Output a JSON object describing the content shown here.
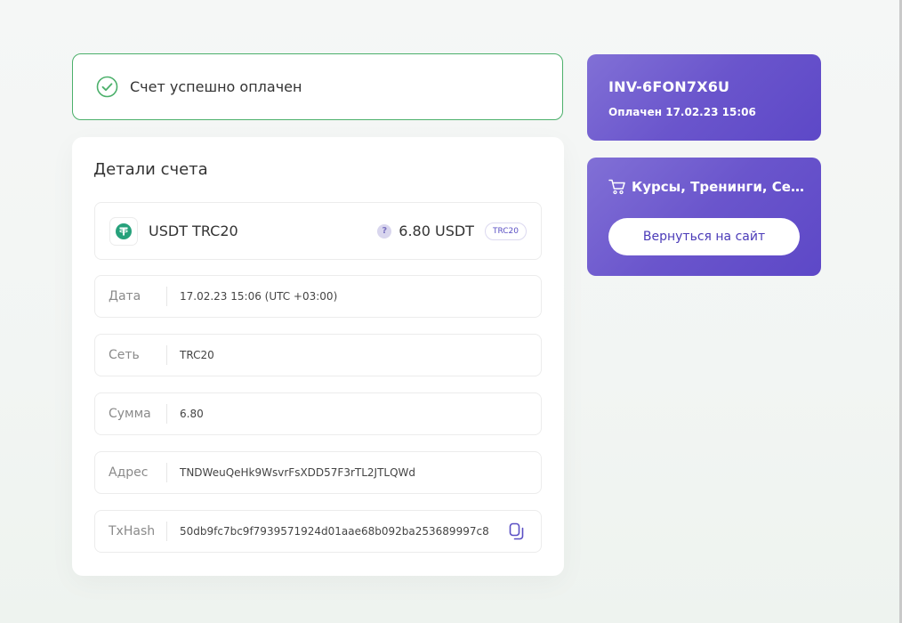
{
  "status": {
    "message": "Счет успешно оплачен"
  },
  "details": {
    "title": "Детали счета",
    "currency": {
      "name": "USDT TRC20",
      "amount": "6.80 USDT",
      "network_badge": "TRC20",
      "help_glyph": "?"
    },
    "rows": [
      {
        "label": "Дата",
        "value": "17.02.23 15:06 (UTC +03:00)"
      },
      {
        "label": "Сеть",
        "value": "TRC20"
      },
      {
        "label": "Сумма",
        "value": "6.80"
      },
      {
        "label": "Адрес",
        "value": "TNDWeuQeHk9WsvrFsXDD57F3rTL2JTLQWd"
      },
      {
        "label": "TxHash",
        "value": "50db9fc7bc9f7939571924d01aae68b092ba253689997c8"
      }
    ]
  },
  "invoice": {
    "id": "INV-6FON7X6U",
    "paid_at": "Оплачен 17.02.23 15:06"
  },
  "shop": {
    "title": "Курсы, Тренинги, Семинары",
    "return_label": "Вернуться на сайт"
  },
  "colors": {
    "success": "#4cb06b",
    "accent": "#6a55cc",
    "tether": "#26a17b"
  },
  "icons": {
    "status": "check-circle-icon",
    "coin": "tether-icon",
    "help": "help-icon",
    "copy": "copy-icon",
    "cart": "cart-icon"
  }
}
